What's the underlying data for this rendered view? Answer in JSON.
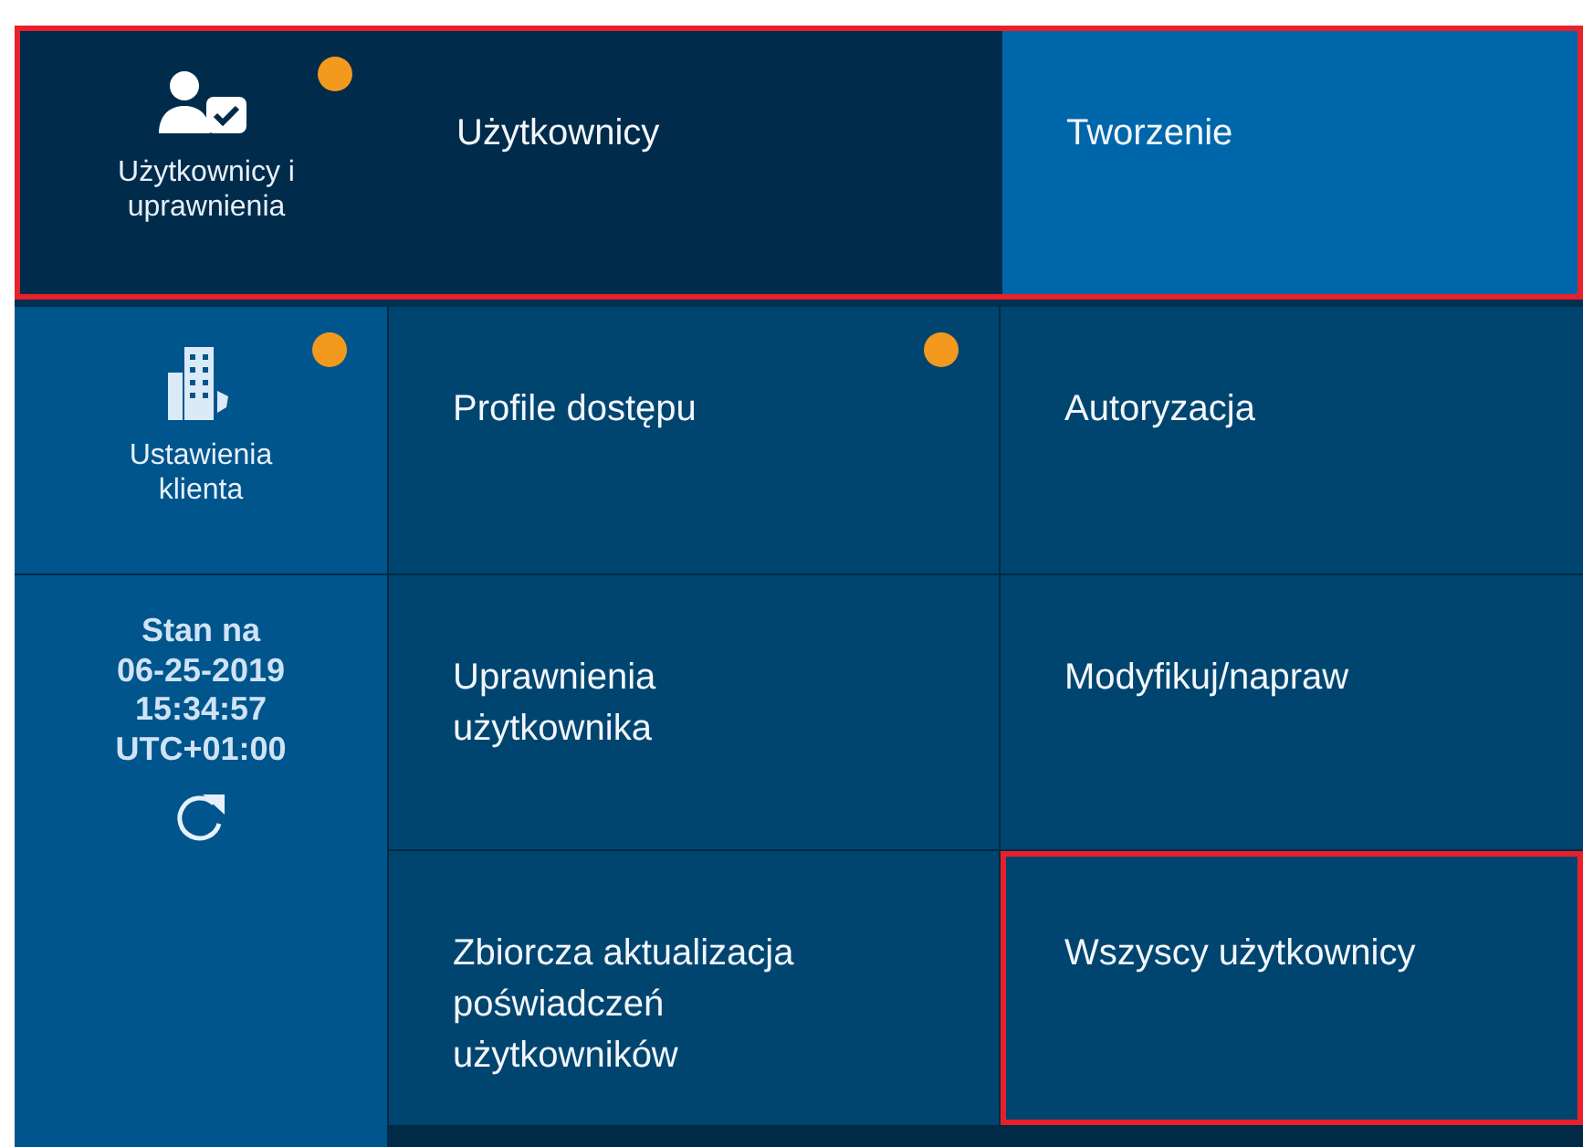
{
  "sidebar": {
    "items": [
      {
        "label": "Użytkownicy i uprawnienia",
        "kind": "user",
        "selected": true,
        "notification": true
      },
      {
        "label": "Ustawienia klienta",
        "kind": "building",
        "selected": false,
        "notification": true
      }
    ],
    "status": {
      "heading": "Stan na",
      "date": "06-25-2019",
      "time": "15:34:57",
      "timezone": "UTC+01:00"
    }
  },
  "top_row_outlined": true,
  "menu": [
    {
      "label": "Użytkownicy",
      "selected": true,
      "notification": false
    },
    {
      "label": "Profile dostępu",
      "selected": false,
      "notification": true
    },
    {
      "label": "Uprawnienia użytkownika",
      "selected": false,
      "notification": false
    },
    {
      "label": "Zbiorcza aktualizacja poświadczeń użytkowników",
      "selected": false,
      "notification": false
    }
  ],
  "submenu": [
    {
      "label": "Tworzenie",
      "selected": true,
      "outlined": false
    },
    {
      "label": "Autoryzacja",
      "selected": false,
      "outlined": false
    },
    {
      "label": "Modyfikuj/napraw",
      "selected": false,
      "outlined": false
    },
    {
      "label": "Wszyscy użytkownicy",
      "selected": false,
      "outlined": true
    }
  ]
}
